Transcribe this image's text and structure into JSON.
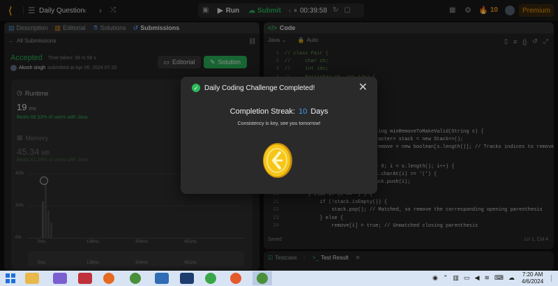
{
  "topbar": {
    "problem_title": "Daily Question",
    "run_label": "Run",
    "submit_label": "Submit",
    "timer": "00:39:58",
    "streak_count": "10",
    "premium_label": "Premium",
    "accent": "#ffa116"
  },
  "left_tabs": [
    {
      "label": "Description"
    },
    {
      "label": "Editorial"
    },
    {
      "label": "Solutions"
    },
    {
      "label": "Submissions"
    }
  ],
  "submissions": {
    "back_label": "All Submissions",
    "status": "Accepted",
    "time_taken": "Time taken: 39 m 58 s",
    "user_line": "Akosh singh",
    "submitted_at": "submitted at Apr 06, 2024 07:20",
    "editorial_button": "Editorial",
    "solution_button": "Solution",
    "runtime_label": "Runtime",
    "runtime_value": "19",
    "runtime_unit": "ms",
    "runtime_beats": "Beats 66.53% of users with Java",
    "memory_label": "Memory",
    "memory_value": "45.34",
    "memory_unit": "MB",
    "memory_beats": "Beats 61.59% of users with Java",
    "chart_ylabels": [
      "40%",
      "20%",
      "0%"
    ],
    "chart_xlabels": [
      "0ms",
      "138ms",
      "304ms",
      "451ms"
    ],
    "chart_xlabels2": [
      "0ms",
      "138ms",
      "304ms",
      "451ms"
    ]
  },
  "code_panel": {
    "title": "Code",
    "language": "Java",
    "mode": "Auto",
    "status_left": "Saved",
    "status_right": "Ln 1, Col 4",
    "lines_top": [
      {
        "n": "1",
        "text": "// class Pair {"
      },
      {
        "n": "2",
        "text": "//     char ch;"
      },
      {
        "n": "3",
        "text": "//     int idx;"
      },
      {
        "n": "4",
        "text": "//     Pair(char ch, int idx) {"
      }
    ],
    "lines_mid": [
      {
        "n": "",
        "text": "ring minRemoveToMakeValid(String s) {"
      },
      {
        "n": "",
        "text": "racter> stack = new Stack<>();"
      },
      {
        "n": "",
        "text": "remove = new boolean[s.length()]; // Tracks indices to remove"
      }
    ],
    "lines_mid2": [
      {
        "n": "",
        "text": "= 0; i < s.length(); i++) {"
      },
      {
        "n": "",
        "text": "s.charAt(i) == '(') {"
      },
      {
        "n": "",
        "text": "ack.push(i);"
      }
    ],
    "lines_bottom": [
      {
        "n": "20",
        "text": "        } else if (c == ')') {"
      },
      {
        "n": "21",
        "text": "            if (!stack.isEmpty()) {"
      },
      {
        "n": "22",
        "text": "                stack.pop(); // Matched, so remove the corresponding opening parenthesis"
      },
      {
        "n": "23",
        "text": "            } else {"
      },
      {
        "n": "24",
        "text": "                remove[i] = true; // Unmatched closing parenthesis"
      }
    ]
  },
  "bottom_tabs": [
    {
      "label": "Testcase"
    },
    {
      "label": "Test Result"
    }
  ],
  "modal": {
    "title": "Daily Coding Challenge Completed!",
    "streak_label": "Completion Streak:",
    "streak_number": "10",
    "streak_unit": "Days",
    "subtitle": "Consistency is key, see you tomorrow!",
    "coin_color": "#f5c518"
  },
  "taskbar": {
    "time": "7:20 AM",
    "date": "4/6/2024"
  }
}
